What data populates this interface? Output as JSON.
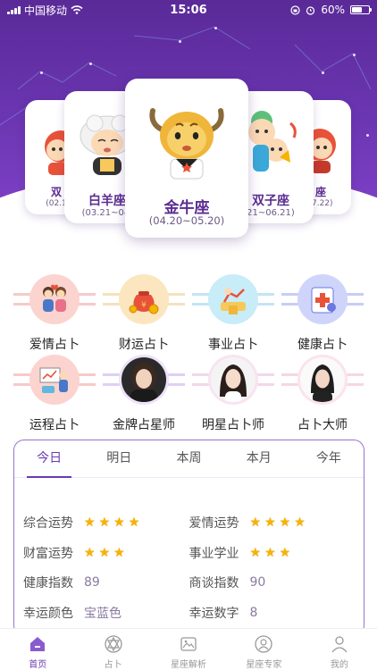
{
  "status_bar": {
    "carrier": "中国移动",
    "time": "15:06",
    "battery": "60%",
    "battery_level": 0.6
  },
  "zodiac_cards": [
    {
      "name": "双",
      "date": "(02.1",
      "position": "far-left"
    },
    {
      "name": "白羊座",
      "date": "(03.21~04.",
      "position": "left"
    },
    {
      "name": "金牛座",
      "date": "(04.20~05.20)",
      "position": "center",
      "selected": true
    },
    {
      "name": "双子座",
      "date": "21~06.21)",
      "position": "right"
    },
    {
      "name": "座",
      "date": ")7.22)",
      "position": "far-right"
    }
  ],
  "features": [
    {
      "label": "爱情占卜",
      "icon": "couple-icon",
      "color": "#e98a8a"
    },
    {
      "label": "财运占卜",
      "icon": "money-bag-icon",
      "color": "#e8b85c"
    },
    {
      "label": "事业占卜",
      "icon": "career-icon",
      "color": "#5fb8e0"
    },
    {
      "label": "健康占卜",
      "icon": "health-icon",
      "color": "#6a78e0"
    },
    {
      "label": "运程占卜",
      "icon": "fortune-chart-icon",
      "color": "#e98a8a"
    },
    {
      "label": "金牌占星师",
      "icon": "astrologer-avatar",
      "color": "#9b6ad0"
    },
    {
      "label": "明星占卜师",
      "icon": "star-diviner-avatar",
      "color": "#d98cb8"
    },
    {
      "label": "占卜大师",
      "icon": "master-avatar",
      "color": "#e59cb4"
    }
  ],
  "fortune": {
    "tabs": [
      "今日",
      "明日",
      "本周",
      "本月",
      "今年"
    ],
    "active_tab": 0,
    "rows": [
      [
        {
          "key": "综合运势",
          "stars": 4
        },
        {
          "key": "爱情运势",
          "stars": 4
        }
      ],
      [
        {
          "key": "财富运势",
          "stars": 3
        },
        {
          "key": "事业学业",
          "stars": 3
        }
      ],
      [
        {
          "key": "健康指数",
          "value": "89"
        },
        {
          "key": "商谈指数",
          "value": "90"
        }
      ],
      [
        {
          "key": "幸运颜色",
          "value": "宝蓝色"
        },
        {
          "key": "幸运数字",
          "value": "8"
        }
      ]
    ]
  },
  "tabbar": [
    {
      "label": "首页",
      "icon": "home-icon",
      "active": true
    },
    {
      "label": "占卜",
      "icon": "hexagram-icon"
    },
    {
      "label": "星座解析",
      "icon": "picture-frame-icon"
    },
    {
      "label": "星座专家",
      "icon": "expert-avatar-icon"
    },
    {
      "label": "我的",
      "icon": "profile-icon"
    }
  ],
  "colors": {
    "primary": "#6a3ab0",
    "header": "#5a2a98",
    "star": "#f5b400"
  }
}
